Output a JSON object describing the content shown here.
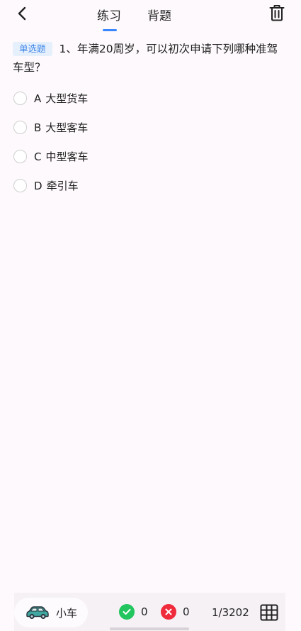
{
  "header": {
    "tabs": [
      {
        "label": "练习",
        "active": true
      },
      {
        "label": "背题",
        "active": false
      }
    ],
    "accent_color": "#3a86ff"
  },
  "question": {
    "type_badge": "单选题",
    "text": "1、年满20周岁，可以初次申请下列哪种准驾车型？"
  },
  "options": [
    {
      "letter": "A",
      "text": "大型货车"
    },
    {
      "letter": "B",
      "text": "大型客车"
    },
    {
      "letter": "C",
      "text": "中型客车"
    },
    {
      "letter": "D",
      "text": "牵引车"
    }
  ],
  "bottom_bar": {
    "vehicle_label": "小车",
    "correct_count": "0",
    "wrong_count": "0",
    "progress": "1/3202",
    "correct_color": "#22c55e",
    "wrong_color": "#ef2b3c"
  }
}
